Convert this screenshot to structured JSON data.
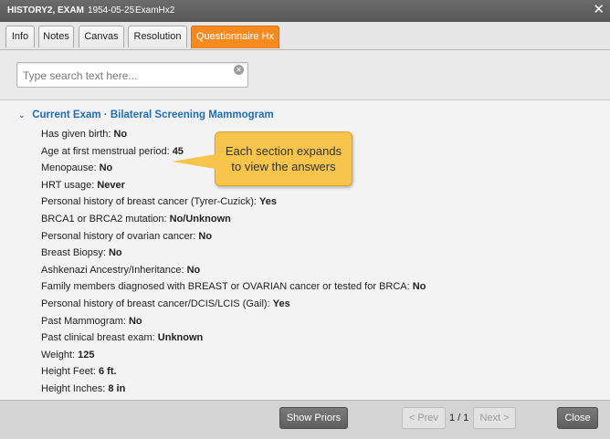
{
  "titlebar": {
    "patient_name": "HISTORY2, EXAM",
    "dob": "1954-05-25",
    "exam_id": "ExamHx2",
    "close_icon": "close-icon"
  },
  "tabs": [
    {
      "label": "Info",
      "active": false
    },
    {
      "label": "Notes",
      "active": false
    },
    {
      "label": "Canvas",
      "active": false
    },
    {
      "label": "Resolution",
      "active": false
    },
    {
      "label": "Questionnaire Hx",
      "active": true
    }
  ],
  "search": {
    "placeholder": "Type search text here...",
    "value": ""
  },
  "section": {
    "expanded": true,
    "title": "Current Exam · Bilateral Screening Mammogram"
  },
  "questions": [
    {
      "q": "Has given birth: ",
      "a": "No"
    },
    {
      "q": "Age at first menstrual period: ",
      "a": "45"
    },
    {
      "q": "Menopause: ",
      "a": "No"
    },
    {
      "q": "HRT usage: ",
      "a": "Never"
    },
    {
      "q": "Personal history of breast cancer (Tyrer-Cuzick): ",
      "a": "Yes"
    },
    {
      "q": "BRCA1 or BRCA2 mutation: ",
      "a": "No/Unknown"
    },
    {
      "q": "Personal history of ovarian cancer: ",
      "a": "No"
    },
    {
      "q": "Breast Biopsy: ",
      "a": "No"
    },
    {
      "q": "Ashkenazi Ancestry/Inheritance: ",
      "a": "No"
    },
    {
      "q": "Family members diagnosed with BREAST or OVARIAN cancer or tested for BRCA: ",
      "a": "No"
    },
    {
      "q": "Personal history of breast cancer/DCIS/LCIS (Gail): ",
      "a": "Yes"
    },
    {
      "q": "Past Mammogram: ",
      "a": "No"
    },
    {
      "q": "Past clinical breast exam: ",
      "a": "Unknown"
    },
    {
      "q": "Weight: ",
      "a": "125"
    },
    {
      "q": "Height Feet: ",
      "a": "6 ft."
    },
    {
      "q": "Height Inches: ",
      "a": "8 in"
    }
  ],
  "callout": {
    "line1": "Each section expands",
    "line2": "to view the answers"
  },
  "footer": {
    "show_priors": "Show Priors",
    "prev": "< Prev",
    "page": "1 / 1",
    "next": "Next >",
    "close": "Close"
  },
  "colors": {
    "active_tab": "#f58a1f",
    "section_link": "#1f6db5",
    "callout": "#f7c54b"
  }
}
